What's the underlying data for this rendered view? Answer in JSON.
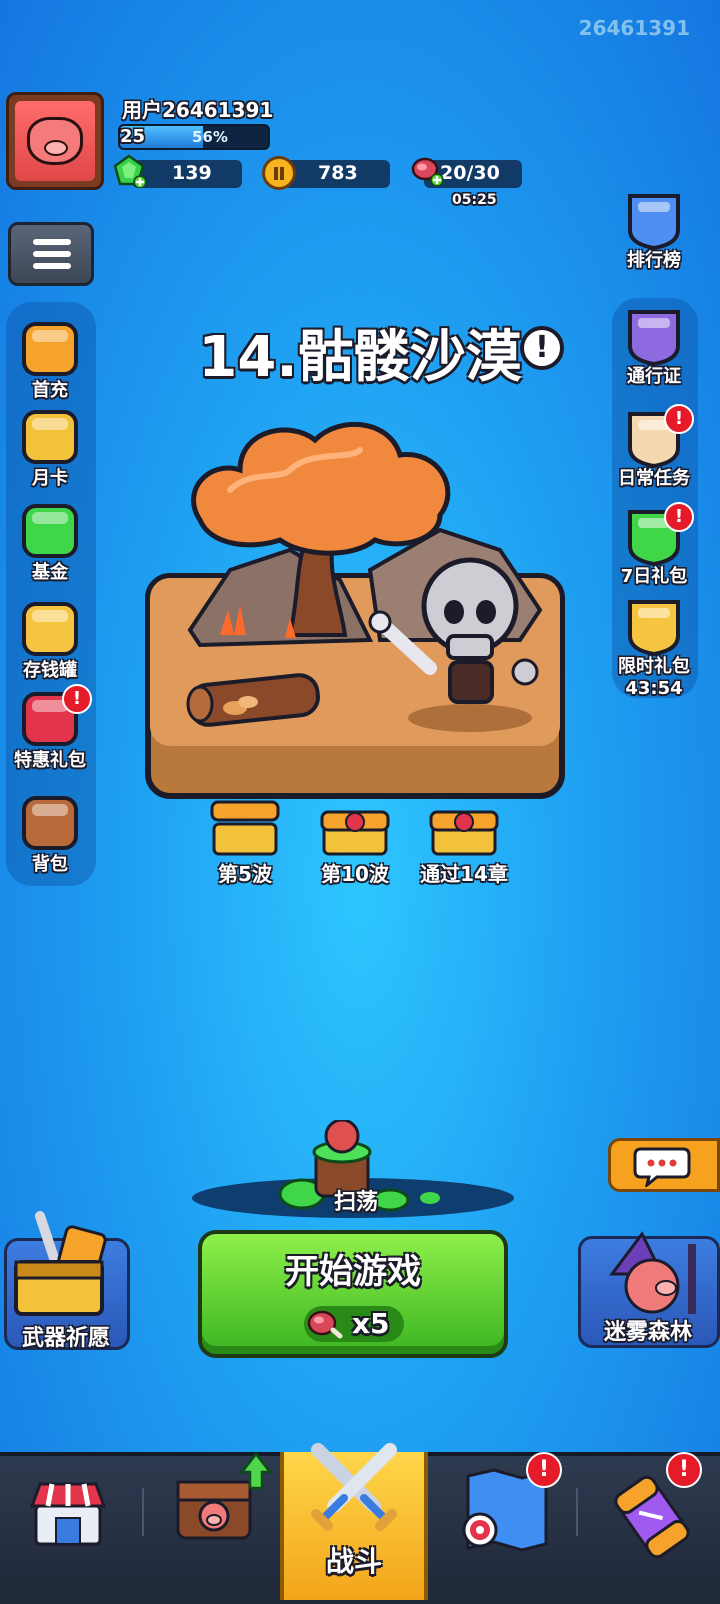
{
  "player_id_corner": "26461391",
  "profile": {
    "username": "用户26461391",
    "level": "25",
    "xp_percent": "56%",
    "xp_fraction": 0.56
  },
  "resources": {
    "gems": "139",
    "coins": "783",
    "stamina": "20/30",
    "stamina_timer": "05:25"
  },
  "left_menu": [
    {
      "label": "首充",
      "icon": "first-recharge-icon"
    },
    {
      "label": "月卡",
      "icon": "monthly-card-icon"
    },
    {
      "label": "基金",
      "icon": "fund-gem-icon"
    },
    {
      "label": "存钱罐",
      "icon": "lucky-cat-piggybank-icon"
    },
    {
      "label": "特惠礼包",
      "icon": "special-gift-icon",
      "badge": "!"
    },
    {
      "label": "背包",
      "icon": "backpack-icon"
    }
  ],
  "right_menu": [
    {
      "label": "排行榜",
      "icon": "leaderboard-trophy-icon"
    },
    {
      "label": "通行证",
      "icon": "pass-shield-icon"
    },
    {
      "label": "日常任务",
      "icon": "daily-quest-scroll-icon",
      "badge": "!"
    },
    {
      "label": "7日礼包",
      "icon": "seven-day-gift-icon",
      "badge": "!"
    },
    {
      "label": "限时礼包",
      "icon": "limited-gift-icon",
      "timer": "43:54"
    }
  ],
  "stage": {
    "title": "14.骷髅沙漠",
    "info_glyph": "!"
  },
  "chapter_rewards": [
    {
      "label": "第5波",
      "type": "opened"
    },
    {
      "label": "第10波",
      "type": "closed"
    },
    {
      "label": "通过14章",
      "type": "closed"
    }
  ],
  "sweep": {
    "label": "扫荡"
  },
  "start": {
    "label": "开始游戏",
    "cost": "x5"
  },
  "side_modes": {
    "left": "武器祈愿",
    "right": "迷雾森林"
  },
  "nav": {
    "items": [
      "shop-icon",
      "equipment-chest-icon",
      "battle-swords-icon",
      "map-target-icon",
      "potion-capsule-icon"
    ],
    "active_label": "战斗"
  },
  "colors": {
    "accent_green": "#52d12c",
    "badge_red": "#e51b2a",
    "nav_active": "#f7c136",
    "bg_blue": "#1fa0f2"
  }
}
